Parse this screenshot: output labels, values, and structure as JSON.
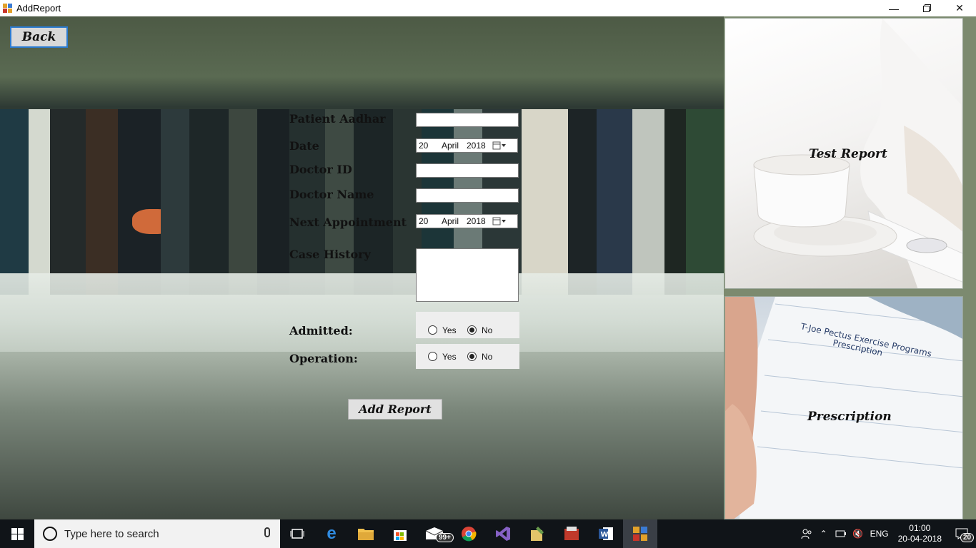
{
  "window": {
    "title": "AddReport",
    "minimize_icon": "minimize-icon",
    "restore_icon": "restore-icon",
    "close_icon": "close-icon"
  },
  "back_button": "Back",
  "form": {
    "patient_aadhar_label": "Patient Aadhar",
    "patient_aadhar_value": "",
    "date_label": "Date",
    "date_day": "20",
    "date_month": "April",
    "date_year": "2018",
    "doctor_id_label": "Doctor ID",
    "doctor_id_value": "",
    "doctor_name_label": "Doctor Name",
    "doctor_name_value": "",
    "next_appointment_label": "Next Appointment",
    "next_day": "20",
    "next_month": "April",
    "next_year": "2018",
    "case_history_label": "Case History",
    "case_history_value": "",
    "admitted_label": "Admitted:",
    "admitted_yes": "Yes",
    "admitted_no": "No",
    "admitted_selected": "No",
    "operation_label": "Operation:",
    "operation_yes": "Yes",
    "operation_no": "No",
    "operation_selected": "No",
    "add_report_button": "Add Report"
  },
  "side_tiles": {
    "test_report": "Test Report",
    "prescription": "Prescription"
  },
  "taskbar": {
    "search_placeholder": "Type here to search",
    "mail_badge": "99+",
    "language": "ENG",
    "time": "01:00",
    "date": "20-04-2018",
    "notification_count": "20"
  }
}
